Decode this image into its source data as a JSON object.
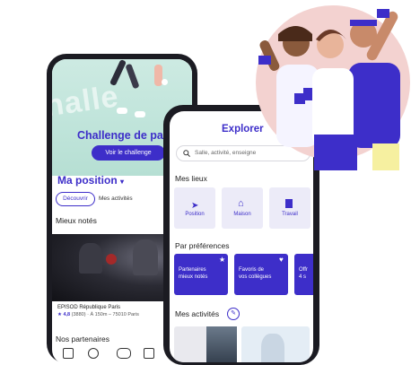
{
  "back_phone": {
    "hero_text": "Challenge de pas",
    "challenge_button": "Voir le challenge",
    "position_title": "Ma position",
    "tabs": [
      "Découvrir",
      "Mes activités"
    ],
    "best_rated_title": "Mieux notés",
    "card": {
      "name": "EPISOD République Paris",
      "rating": "4,8",
      "meta": "(3880) · À 150m – 75010 Paris"
    },
    "partners_title": "Nos partenaires"
  },
  "front_phone": {
    "title": "Explorer",
    "search_placeholder": "Salle, activité, enseigne",
    "places_title": "Mes lieux",
    "places": [
      "Position",
      "Maison",
      "Travail"
    ],
    "preferences_title": "Par préférences",
    "preferences": [
      {
        "line1": "Partenaires",
        "line2": "mieux notés"
      },
      {
        "line1": "Favoris de",
        "line2": "vos collègues"
      },
      {
        "line1": "Offr",
        "line2": "4 s"
      }
    ],
    "activities_title": "Mes activités"
  },
  "colors": {
    "accent": "#3d2ec9",
    "hero_bg": "#bfe4da",
    "circle_bg": "#f3d2d0"
  }
}
